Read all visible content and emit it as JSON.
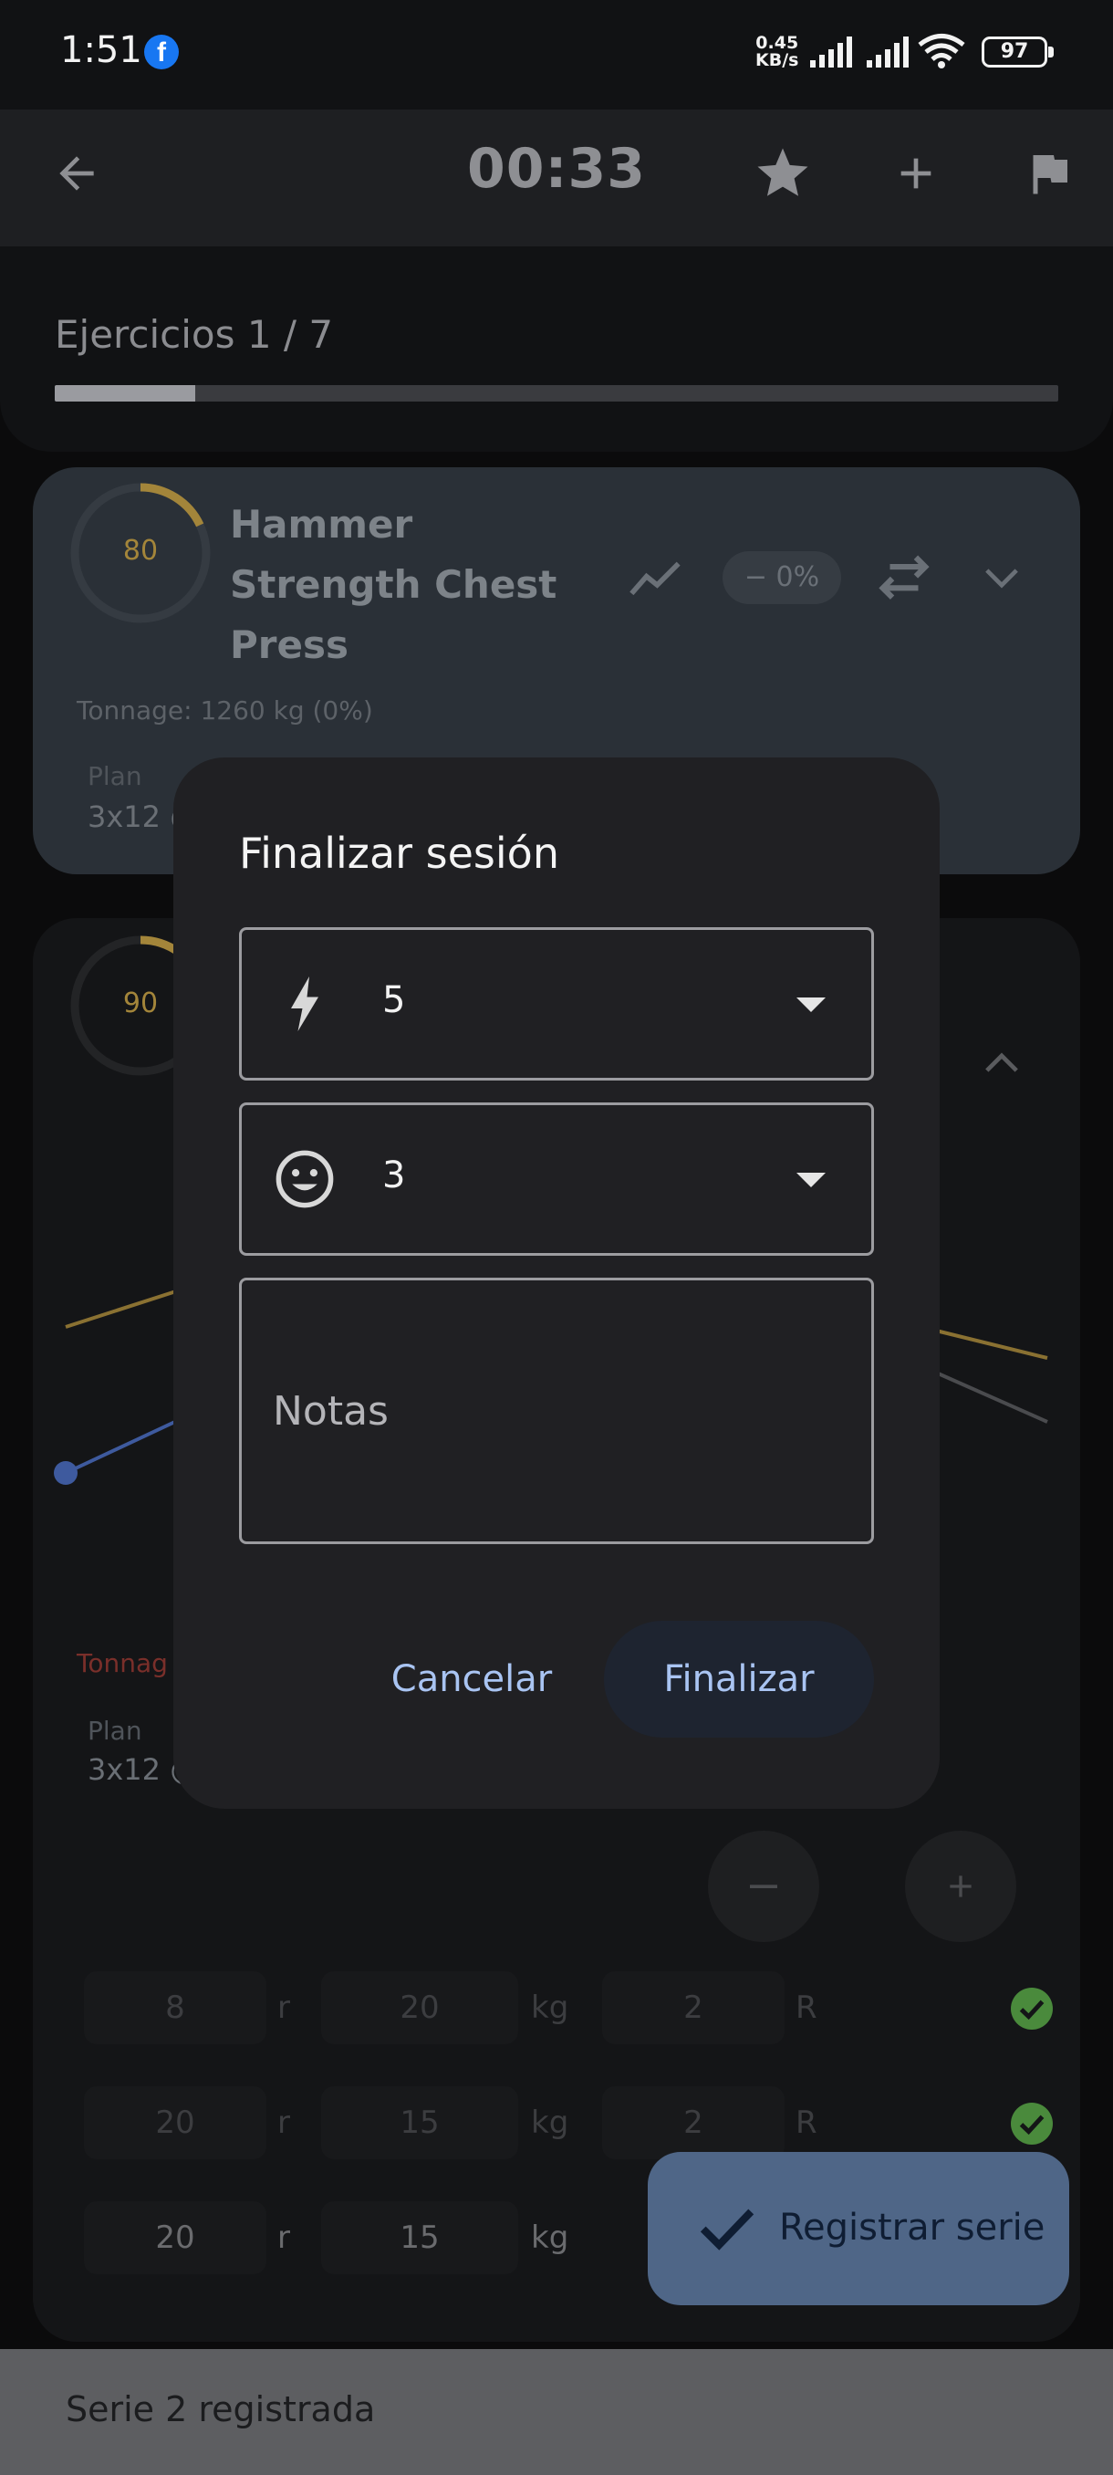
{
  "status_bar": {
    "time": "1:51",
    "app_icon": "facebook-icon",
    "net_speed_value": "0.45",
    "net_speed_unit": "KB/s",
    "battery": "97"
  },
  "app_bar": {
    "timer": "00:33",
    "icons": [
      "back-arrow-icon",
      "star-icon",
      "plus-icon",
      "flag-icon"
    ]
  },
  "progress": {
    "label": "Ejercicios 1 / 7",
    "fraction": 0.14
  },
  "exercise1": {
    "ring_value": "80",
    "ring_fraction": 0.18,
    "title": "Hammer Strength Chest Press",
    "change_badge": "− 0%",
    "tonnage": "Tonnage: 1260 kg (0%)",
    "plan_label": "Plan",
    "plan_value": "3x12 @"
  },
  "exercise2": {
    "ring_value": "90",
    "ring_fraction": 0.1,
    "tonnage_partial": "Tonnag",
    "plan_label": "Plan",
    "plan_value": "3x12 @",
    "sets": [
      {
        "reps": "8",
        "reps_unit": "r",
        "weight": "20",
        "weight_unit": "kg",
        "rir": "2",
        "rir_unit": "R",
        "done": true
      },
      {
        "reps": "20",
        "reps_unit": "r",
        "weight": "15",
        "weight_unit": "kg",
        "rir": "2",
        "rir_unit": "R",
        "done": true
      },
      {
        "reps": "20",
        "reps_unit": "r",
        "weight": "15",
        "weight_unit": "kg"
      }
    ]
  },
  "dialog": {
    "title": "Finalizar sesión",
    "energy_value": "5",
    "mood_value": "3",
    "notes_placeholder": "Notas",
    "cancel_label": "Cancelar",
    "confirm_label": "Finalizar"
  },
  "fab": {
    "label": "Registrar serie"
  },
  "snackbar": {
    "text": "Serie 2 registrada"
  },
  "colors": {
    "accent_gold": "#a3853a",
    "series_blue": "#3e5a9e",
    "done_green": "#4a8a3c",
    "dialog_action": "#a9c4f2",
    "fab_bg": "#4f6687"
  }
}
